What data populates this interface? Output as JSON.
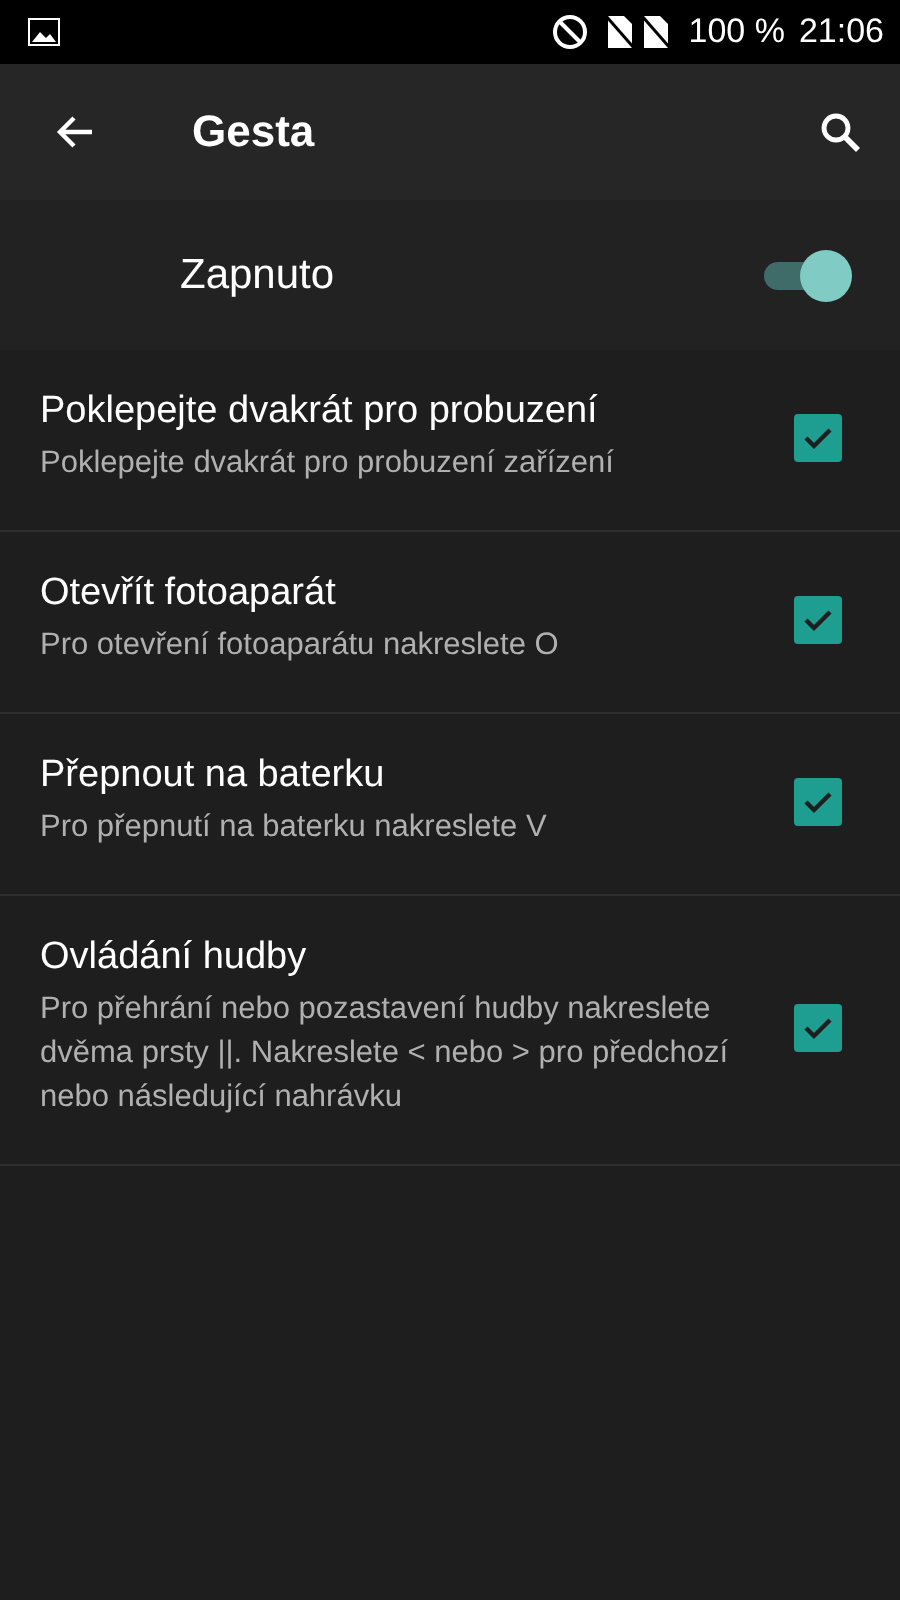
{
  "status_bar": {
    "battery": "100 %",
    "time": "21:06"
  },
  "toolbar": {
    "title": "Gesta"
  },
  "master": {
    "label": "Zapnuto",
    "on": true
  },
  "items": [
    {
      "title": "Poklepejte dvakrát pro probuzení",
      "summary": "Poklepejte dvakrát pro probuzení zařízení",
      "checked": true
    },
    {
      "title": "Otevřít fotoaparát",
      "summary": "Pro otevření fotoaparátu nakreslete O",
      "checked": true
    },
    {
      "title": "Přepnout na baterku",
      "summary": "Pro přepnutí na baterku nakreslete V",
      "checked": true
    },
    {
      "title": "Ovládání hudby",
      "summary": "Pro přehrání nebo pozastavení hudby nakreslete dvěma prsty ||. Nakreslete < nebo > pro předchozí nebo následující nahrávku",
      "checked": true
    }
  ]
}
